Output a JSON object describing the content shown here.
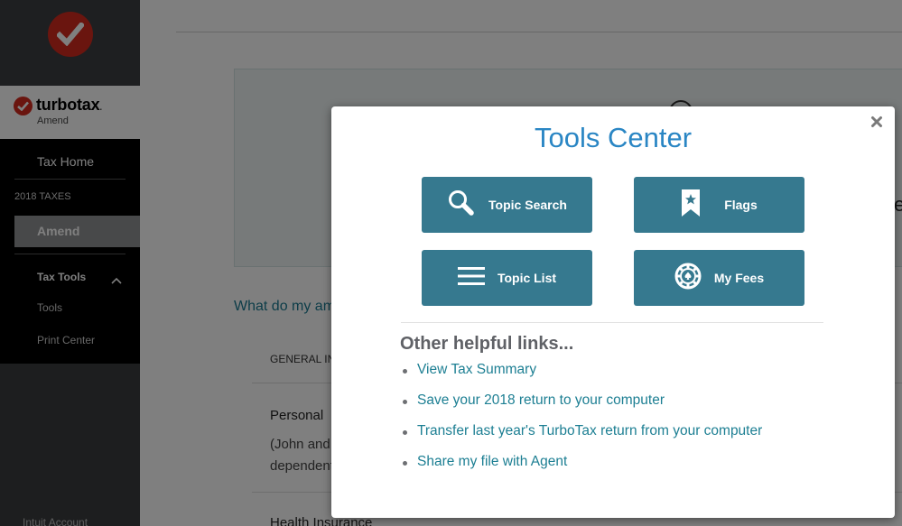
{
  "sidebar": {
    "brand_name": "turbotax",
    "brand_sub": "Amend",
    "nav": {
      "tax_home": "Tax Home",
      "section_label": "2018 TAXES",
      "amend": "Amend",
      "tax_tools": "Tax Tools",
      "tools": "Tools",
      "print_center": "Print Center"
    },
    "account": "Intuit Account"
  },
  "main": {
    "question": "What do my am",
    "general_header": "GENERAL IN",
    "personal_title": "Personal",
    "personal_sub": "(John and\ndependents",
    "health": "Health Insurance"
  },
  "modal": {
    "title": "Tools Center",
    "close_icon": "close-icon",
    "buttons": [
      {
        "label": "Topic Search",
        "icon": "search-icon"
      },
      {
        "label": "Flags",
        "icon": "bookmark-star-icon"
      },
      {
        "label": "Topic List",
        "icon": "list-icon"
      },
      {
        "label": "My Fees",
        "icon": "poker-chip-icon"
      }
    ],
    "links_heading": "Other helpful links...",
    "links": [
      "View Tax Summary",
      "Save your 2018 return to your computer",
      "Transfer last year's TurboTax return from your computer",
      "Share my file with Agent"
    ]
  },
  "colors": {
    "brand_red": "#d52b1e",
    "button_teal": "#36798f",
    "title_blue": "#2a86c4",
    "link_teal": "#1d7f93"
  }
}
